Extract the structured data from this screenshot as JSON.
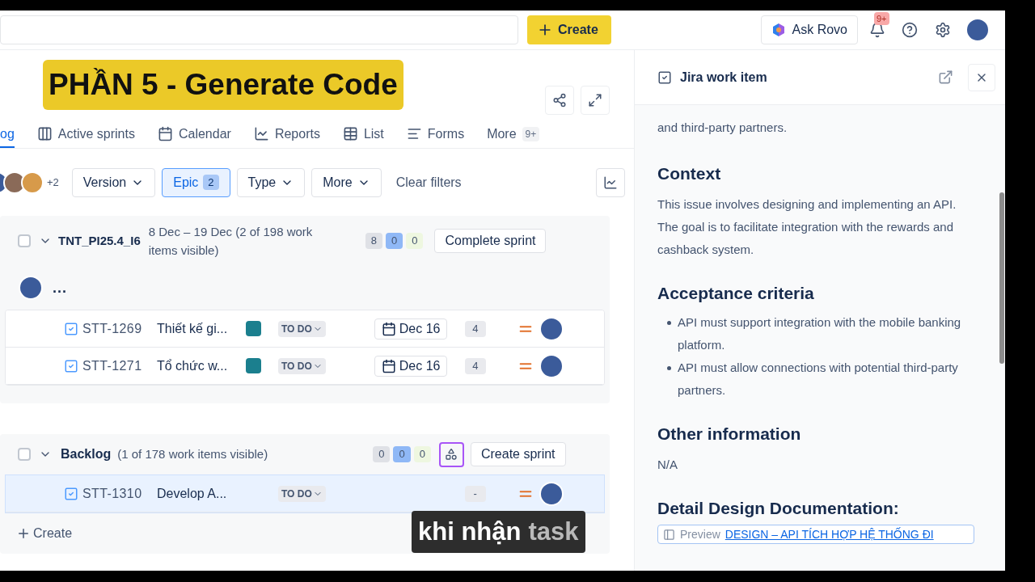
{
  "topbar": {
    "create": "Create",
    "ask_rovo": "Ask Rovo",
    "notifications_badge": "9+"
  },
  "banner": "PHẦN 5 - Generate Code",
  "tabs": [
    {
      "label": "og",
      "selected": true
    },
    {
      "label": "Active sprints",
      "selected": false
    },
    {
      "label": "Calendar",
      "selected": false
    },
    {
      "label": "Reports",
      "selected": false
    },
    {
      "label": "List",
      "selected": false
    },
    {
      "label": "Forms",
      "selected": false
    },
    {
      "label": "More",
      "badge": "9+",
      "selected": false
    }
  ],
  "filters": {
    "extra_avatars": "+2",
    "buttons": [
      {
        "label": "Version",
        "selected": false
      },
      {
        "label": "Epic",
        "count": "2",
        "selected": true
      },
      {
        "label": "Type",
        "selected": false
      },
      {
        "label": "More",
        "selected": false
      }
    ],
    "clear": "Clear filters"
  },
  "sprint": {
    "name": "TNT_PI25.4_I6",
    "checked": false,
    "expanded": true,
    "dates": "8 Dec – 19 Dec (2 of 198 work items visible)",
    "counts": [
      "8",
      "0",
      "0"
    ],
    "action": "Complete sprint",
    "more": "...",
    "items": [
      {
        "key": "STT-1269",
        "summary": "Thiết kế gi...",
        "color": "#1b7f8e",
        "status": "TO DO",
        "due": "Dec 16",
        "points": "4",
        "selected": false
      },
      {
        "key": "STT-1271",
        "summary": "Tổ chức w...",
        "color": "#1b7f8e",
        "status": "TO DO",
        "due": "Dec 16",
        "points": "4",
        "selected": false
      }
    ]
  },
  "backlog": {
    "name": "Backlog",
    "checked": false,
    "expanded": true,
    "info": "(1 of 178 work items visible)",
    "counts": [
      "0",
      "0",
      "0"
    ],
    "action": "Create sprint",
    "items": [
      {
        "key": "STT-1310",
        "summary": "Develop A...",
        "status": "TO DO",
        "points": "-",
        "selected": true
      }
    ]
  },
  "create_link": "Create",
  "subtitle": [
    {
      "text": "khi nhận",
      "highlight": false
    },
    {
      "text": "task",
      "highlight": true
    }
  ],
  "detail": {
    "title": "Jira work item",
    "intro": "and third-party partners.",
    "sections": [
      {
        "heading": "Context",
        "kind": "paragraph",
        "text": "This issue involves designing and implementing an API. The goal is to facilitate integration with the rewards and cashback system."
      },
      {
        "heading": "Acceptance criteria",
        "kind": "bullets",
        "items": [
          "API must support integration with the mobile banking platform.",
          "API must allow connections with potential third-party partners."
        ]
      },
      {
        "heading": "Other information",
        "kind": "paragraph",
        "text": "N/A"
      },
      {
        "heading": "Detail Design Documentation:",
        "kind": "link",
        "preview": "Preview",
        "text": "DESIGN – API TÍCH HỢP HỆ THỐNG ĐI"
      }
    ]
  }
}
